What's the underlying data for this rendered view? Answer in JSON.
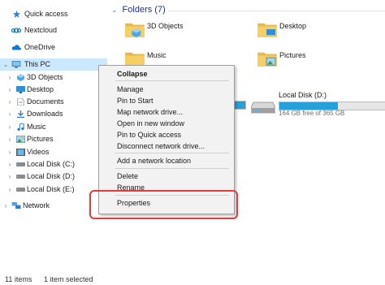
{
  "nav": {
    "items": [
      {
        "label": "Quick access",
        "icon": "star-icon",
        "expandable": false
      },
      {
        "label": "Nextcloud",
        "icon": "nextcloud-icon",
        "expandable": false
      },
      {
        "label": "OneDrive",
        "icon": "onedrive-icon",
        "expandable": false
      },
      {
        "label": "This PC",
        "icon": "pc-icon",
        "expandable": true,
        "expanded": true,
        "selected": true
      },
      {
        "label": "3D Objects",
        "icon": "cube-icon",
        "expandable": true
      },
      {
        "label": "Desktop",
        "icon": "desktop-icon",
        "expandable": true
      },
      {
        "label": "Documents",
        "icon": "documents-icon",
        "expandable": true
      },
      {
        "label": "Downloads",
        "icon": "downloads-icon",
        "expandable": true
      },
      {
        "label": "Music",
        "icon": "music-icon",
        "expandable": true
      },
      {
        "label": "Pictures",
        "icon": "pictures-icon",
        "expandable": true
      },
      {
        "label": "Videos",
        "icon": "videos-icon",
        "expandable": true
      },
      {
        "label": "Local Disk (C:)",
        "icon": "drive-icon",
        "expandable": true
      },
      {
        "label": "Local Disk (D:)",
        "icon": "drive-icon",
        "expandable": true
      },
      {
        "label": "Local Disk (E:)",
        "icon": "drive-icon",
        "expandable": true
      },
      {
        "label": "Network",
        "icon": "network-icon",
        "expandable": true
      }
    ]
  },
  "main": {
    "folders_header": "Folders (7)",
    "folders": [
      "3D Objects",
      "Desktop",
      "Music",
      "Pictures"
    ],
    "drive": {
      "name": "Local Disk (D:)",
      "free_text": "164 GB free of 365 GB",
      "used_fraction": 0.55
    }
  },
  "context_menu": {
    "items": [
      "Collapse",
      "Manage",
      "Pin to Start",
      "Map network drive...",
      "Open in new window",
      "Pin to Quick access",
      "Disconnect network drive...",
      "Add a network location",
      "Delete",
      "Rename",
      "Properties"
    ]
  },
  "status": {
    "count": "11 items",
    "selection": "1 item selected"
  },
  "colors": {
    "selection": "#cce8ff",
    "accent": "#26a0da",
    "highlight": "#e23b3b",
    "header_text": "#1e3287"
  }
}
